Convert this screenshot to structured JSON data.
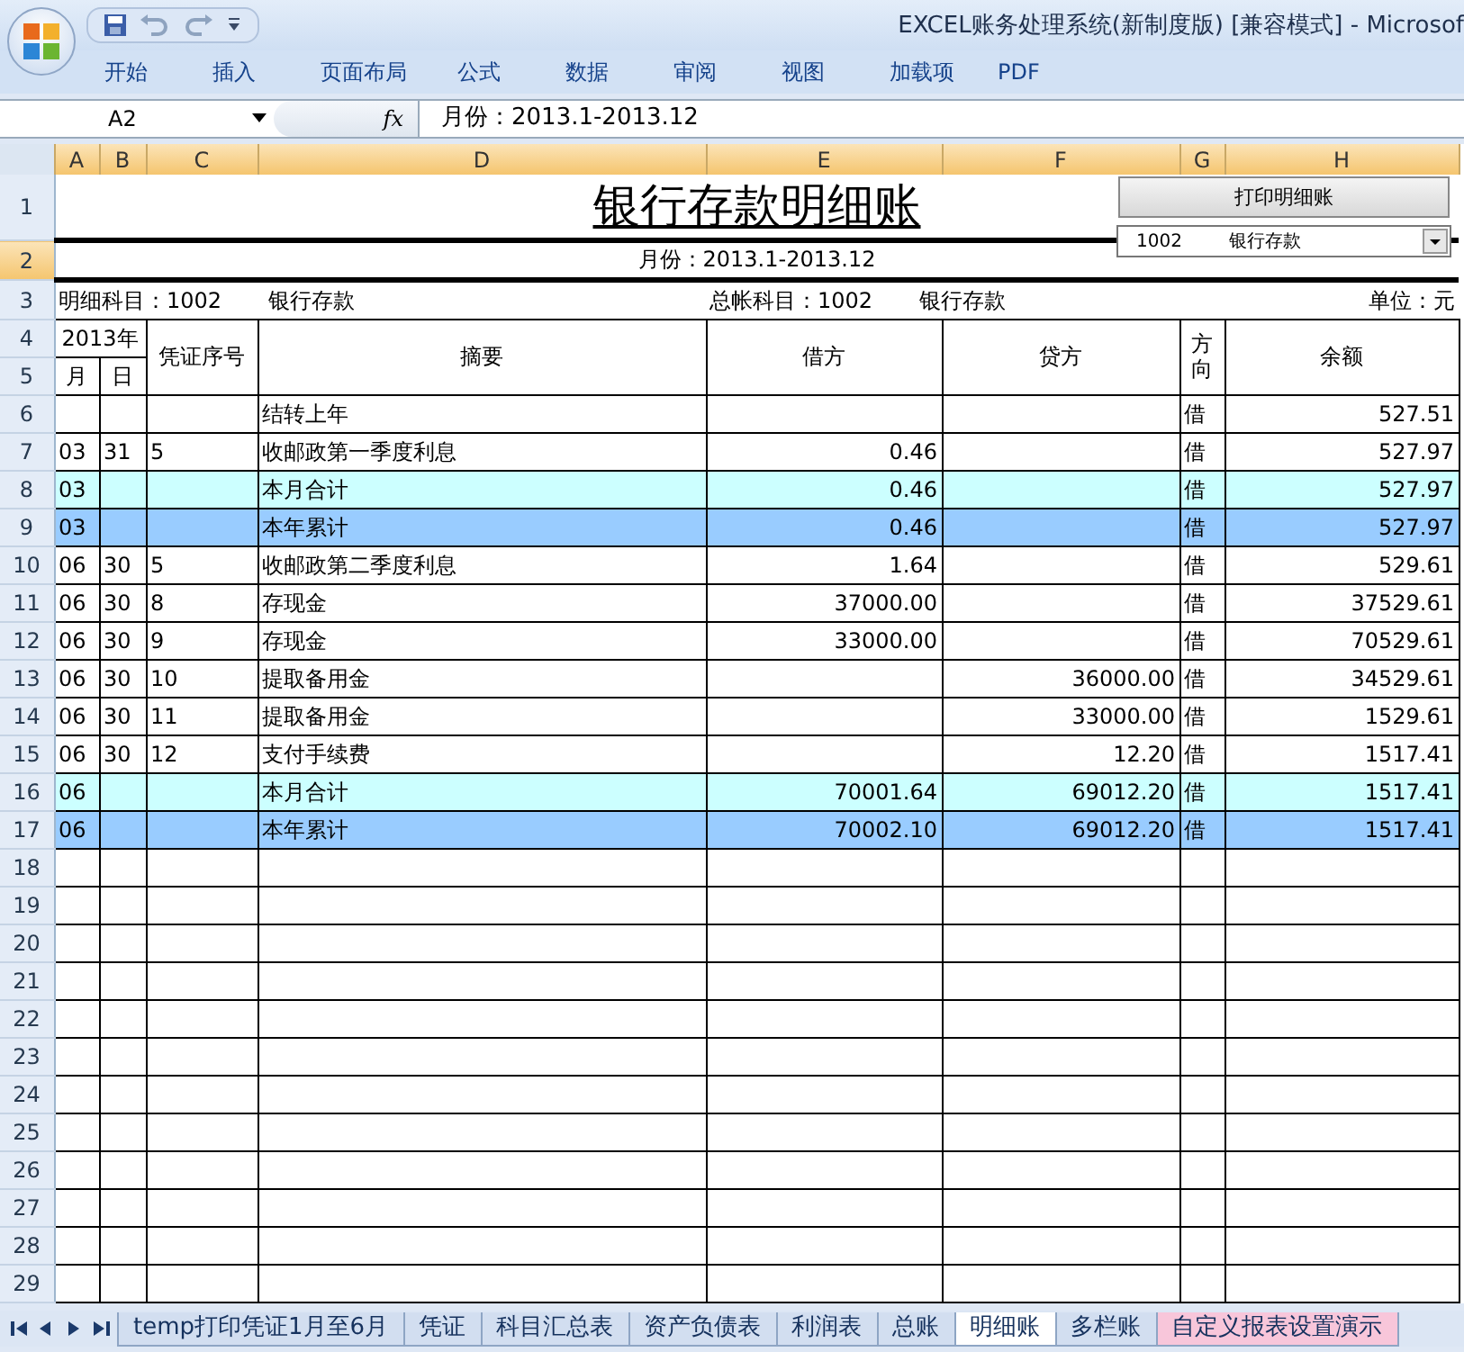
{
  "window": {
    "title": "EXCEL账务处理系统(新制度版)  [兼容模式] - Microsof"
  },
  "ribbon_tabs": [
    "开始",
    "插入",
    "页面布局",
    "公式",
    "数据",
    "审阅",
    "视图",
    "加载项",
    "PDF"
  ],
  "formula_bar": {
    "name_box": "A2",
    "function_label": "fx",
    "formula": "月份：2013.1-2013.12"
  },
  "columns": [
    "A",
    "B",
    "C",
    "D",
    "E",
    "F",
    "G",
    "H"
  ],
  "sheet": {
    "title": "银行存款明细账",
    "period": "月份：2013.1-2013.12",
    "detail_account": "明细科目：1002",
    "detail_name": "银行存款",
    "general_account": "总帐科目：1002",
    "general_name": "银行存款",
    "unit": "单位：元",
    "header": {
      "year": "2013年",
      "month": "月",
      "day": "日",
      "voucher": "凭证序号",
      "summary": "摘要",
      "debit": "借方",
      "credit": "贷方",
      "direction": "方向",
      "balance": "余额"
    },
    "print_button": "打印明细账",
    "account_select": {
      "code": "1002",
      "name": "银行存款"
    }
  },
  "header_row_numbers": [
    "1",
    "2",
    "3",
    "4",
    "5"
  ],
  "rows": [
    {
      "num": "6",
      "kind": "detail",
      "summary": "结转上年",
      "direction": "借",
      "balance": "527.51"
    },
    {
      "num": "7",
      "kind": "detail",
      "month": "03",
      "day": "31",
      "voucher": "5",
      "summary": "收邮政第一季度利息",
      "debit": "0.46",
      "direction": "借",
      "balance": "527.97"
    },
    {
      "num": "8",
      "kind": "month_total",
      "month": "03",
      "summary": "本月合计",
      "debit": "0.46",
      "direction": "借",
      "balance": "527.97"
    },
    {
      "num": "9",
      "kind": "year_total",
      "month": "03",
      "summary": "本年累计",
      "debit": "0.46",
      "direction": "借",
      "balance": "527.97"
    },
    {
      "num": "10",
      "kind": "detail",
      "month": "06",
      "day": "30",
      "voucher": "5",
      "summary": "收邮政第二季度利息",
      "debit": "1.64",
      "direction": "借",
      "balance": "529.61"
    },
    {
      "num": "11",
      "kind": "detail",
      "month": "06",
      "day": "30",
      "voucher": "8",
      "summary": "存现金",
      "debit": "37000.00",
      "direction": "借",
      "balance": "37529.61"
    },
    {
      "num": "12",
      "kind": "detail",
      "month": "06",
      "day": "30",
      "voucher": "9",
      "summary": "存现金",
      "debit": "33000.00",
      "direction": "借",
      "balance": "70529.61"
    },
    {
      "num": "13",
      "kind": "detail",
      "month": "06",
      "day": "30",
      "voucher": "10",
      "summary": "提取备用金",
      "credit": "36000.00",
      "direction": "借",
      "balance": "34529.61"
    },
    {
      "num": "14",
      "kind": "detail",
      "month": "06",
      "day": "30",
      "voucher": "11",
      "summary": "提取备用金",
      "credit": "33000.00",
      "direction": "借",
      "balance": "1529.61"
    },
    {
      "num": "15",
      "kind": "detail",
      "month": "06",
      "day": "30",
      "voucher": "12",
      "summary": "支付手续费",
      "credit": "12.20",
      "direction": "借",
      "balance": "1517.41"
    },
    {
      "num": "16",
      "kind": "month_total",
      "month": "06",
      "summary": "本月合计",
      "debit": "70001.64",
      "credit": "69012.20",
      "direction": "借",
      "balance": "1517.41"
    },
    {
      "num": "17",
      "kind": "year_total",
      "month": "06",
      "summary": "本年累计",
      "debit": "70002.10",
      "credit": "69012.20",
      "direction": "借",
      "balance": "1517.41"
    }
  ],
  "empty_rows": [
    "18",
    "19",
    "20",
    "21",
    "22",
    "23",
    "24",
    "25",
    "26",
    "27",
    "28",
    "29"
  ],
  "sheet_tabs": [
    {
      "label": "temp打印凭证1月至6月",
      "selected": false
    },
    {
      "label": "凭证",
      "selected": false
    },
    {
      "label": "科目汇总表",
      "selected": false
    },
    {
      "label": "资产负债表",
      "selected": false
    },
    {
      "label": "利润表",
      "selected": false
    },
    {
      "label": "总账",
      "selected": false
    },
    {
      "label": "明细账",
      "selected": true
    },
    {
      "label": "多栏账",
      "selected": false
    },
    {
      "label": "自定义报表设置演示",
      "selected": false,
      "color": "#f8c6da"
    }
  ]
}
